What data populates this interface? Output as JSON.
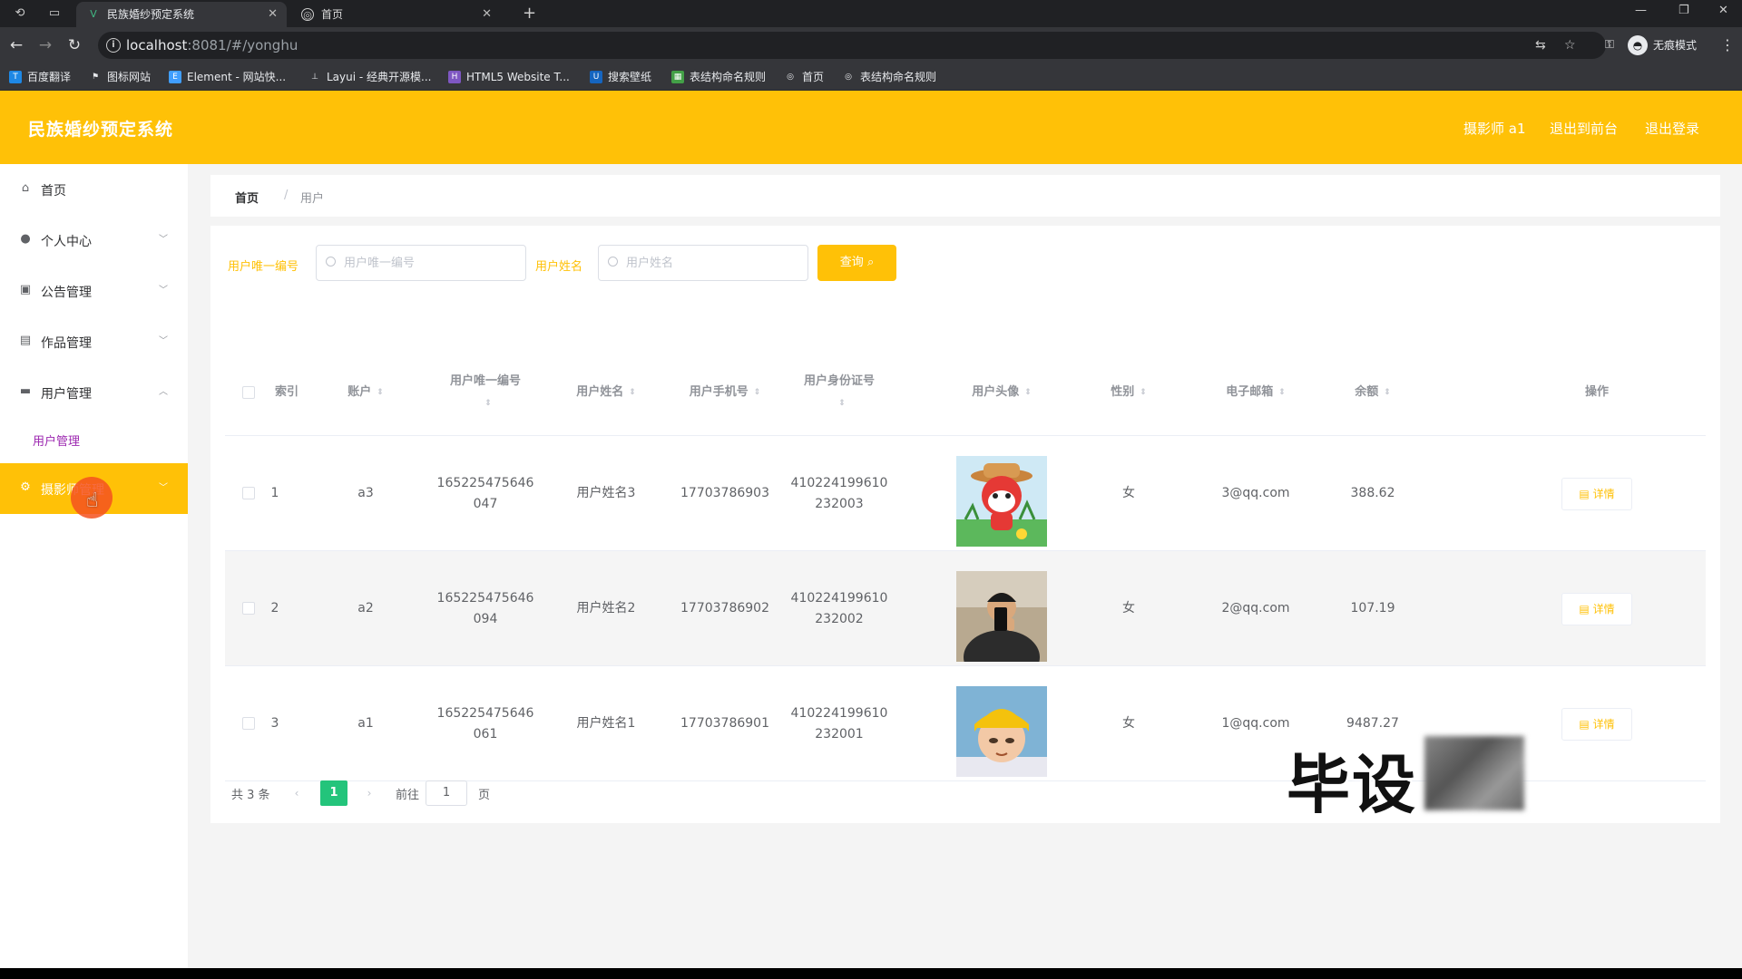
{
  "browser": {
    "tabs": [
      {
        "title": "民族婚纱预定系统",
        "active": true
      },
      {
        "title": "首页",
        "active": false
      }
    ],
    "url_host": "localhost",
    "url_rest": ":8081/#/yonghu",
    "incognito_label": "无痕模式",
    "bookmarks": [
      {
        "label": "百度翻译",
        "icon": "translate-icon",
        "color": "#1e88e5"
      },
      {
        "label": "图标网站",
        "icon": "flag-icon",
        "color": "#e8eaed"
      },
      {
        "label": "Element - 网站快...",
        "icon": "element-icon",
        "color": "#409eff"
      },
      {
        "label": "Layui - 经典开源模...",
        "icon": "layui-icon",
        "color": "#009688"
      },
      {
        "label": "HTML5 Website T...",
        "icon": "html5-icon",
        "color": "#7e57c2"
      },
      {
        "label": "搜索壁纸",
        "icon": "wallpaper-icon",
        "color": "#1565c0"
      },
      {
        "label": "表结构命名规则",
        "icon": "sheet-icon",
        "color": "#43a047"
      },
      {
        "label": "首页",
        "icon": "globe-icon",
        "color": "#e8eaed"
      },
      {
        "label": "表结构命名规则",
        "icon": "globe-icon",
        "color": "#e8eaed"
      }
    ]
  },
  "header": {
    "title": "民族婚纱预定系统",
    "user": "摄影师 a1",
    "back_front": "退出到前台",
    "logout": "退出登录"
  },
  "sidebar": {
    "items": [
      {
        "label": "首页",
        "icon": "home-icon",
        "chevron": ""
      },
      {
        "label": "个人中心",
        "icon": "user-icon",
        "chevron": "﹀"
      },
      {
        "label": "公告管理",
        "icon": "notice-icon",
        "chevron": "﹀"
      },
      {
        "label": "作品管理",
        "icon": "works-icon",
        "chevron": "﹀"
      },
      {
        "label": "用户管理",
        "icon": "users-icon",
        "chevron": "︿"
      },
      {
        "label": "摄影师管理",
        "icon": "camera-icon",
        "chevron": "﹀"
      }
    ],
    "sub_item": "用户管理"
  },
  "breadcrumb": {
    "home": "首页",
    "sep": "/",
    "current": "用户"
  },
  "search": {
    "id_label": "用户唯一编号",
    "id_placeholder": "用户唯一编号",
    "name_label": "用户姓名",
    "name_placeholder": "用户姓名",
    "query_button": "查询"
  },
  "table": {
    "headers": {
      "index": "索引",
      "account": "账户",
      "uid": "用户唯一编号",
      "name": "用户姓名",
      "phone": "用户手机号",
      "idcard": "用户身份证号",
      "avatar": "用户头像",
      "gender": "性别",
      "email": "电子邮箱",
      "balance": "余额",
      "action": "操作"
    },
    "detail_label": "详情",
    "rows": [
      {
        "index": "1",
        "account": "a3",
        "uid_1": "165225475646",
        "uid_2": "047",
        "name": "用户姓名3",
        "phone": "17703786903",
        "idcard_1": "410224199610",
        "idcard_2": "232003",
        "gender": "女",
        "email": "3@qq.com",
        "balance": "388.62"
      },
      {
        "index": "2",
        "account": "a2",
        "uid_1": "165225475646",
        "uid_2": "094",
        "name": "用户姓名2",
        "phone": "17703786902",
        "idcard_1": "410224199610",
        "idcard_2": "232002",
        "gender": "女",
        "email": "2@qq.com",
        "balance": "107.19"
      },
      {
        "index": "3",
        "account": "a1",
        "uid_1": "165225475646",
        "uid_2": "061",
        "name": "用户姓名1",
        "phone": "17703786901",
        "idcard_1": "410224199610",
        "idcard_2": "232001",
        "gender": "女",
        "email": "1@qq.com",
        "balance": "9487.27"
      }
    ]
  },
  "pagination": {
    "total": "共 3 条",
    "current": "1",
    "goto": "前往",
    "goto_value": "1",
    "page": "页"
  },
  "watermark": "毕设"
}
